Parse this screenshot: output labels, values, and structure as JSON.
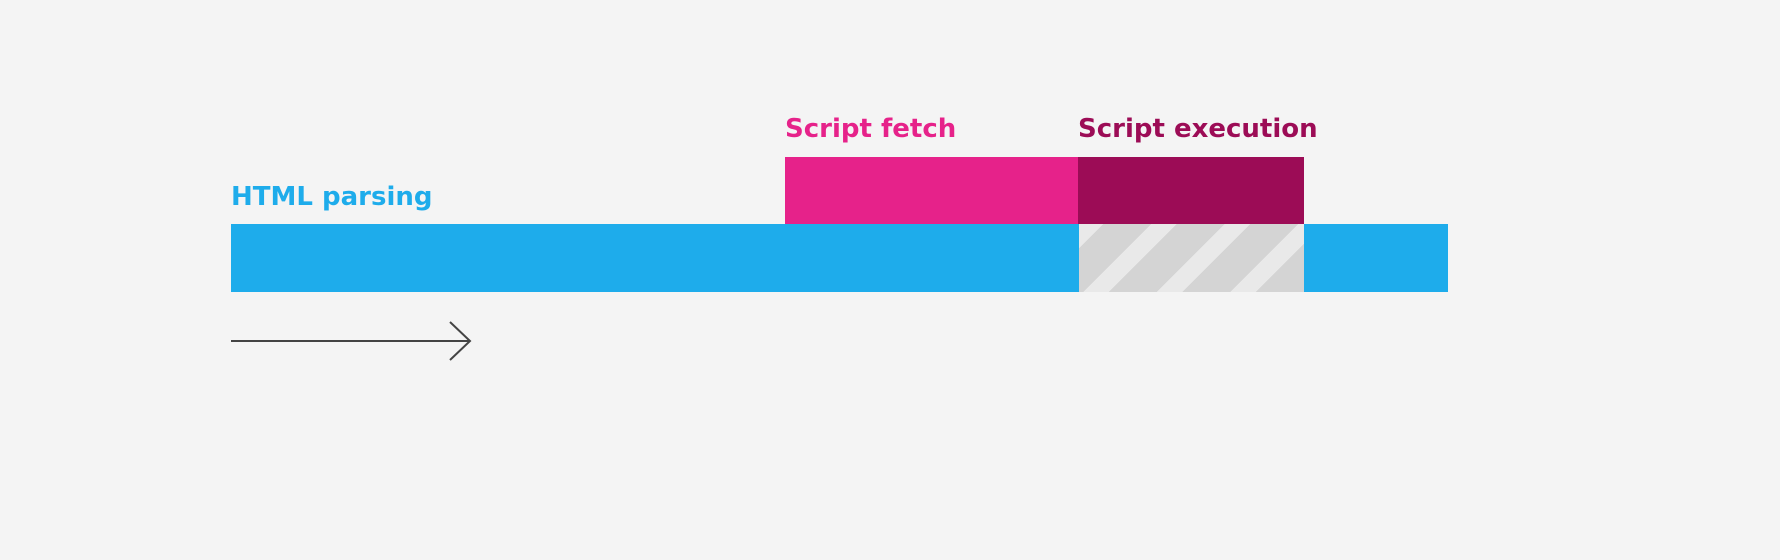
{
  "labels": {
    "html_parsing": "HTML parsing",
    "script_fetch": "Script fetch",
    "script_execution": "Script execution"
  },
  "colors": {
    "background": "#f4f4f4",
    "html_parsing": "#1eaceb",
    "script_fetch": "#e6228a",
    "script_execution": "#9c0c56",
    "paused": "#d4d4d4",
    "arrow": "#444444"
  },
  "icons": {
    "time_arrow": "arrow-right-icon",
    "paused_pattern": "diagonal-stripes"
  }
}
